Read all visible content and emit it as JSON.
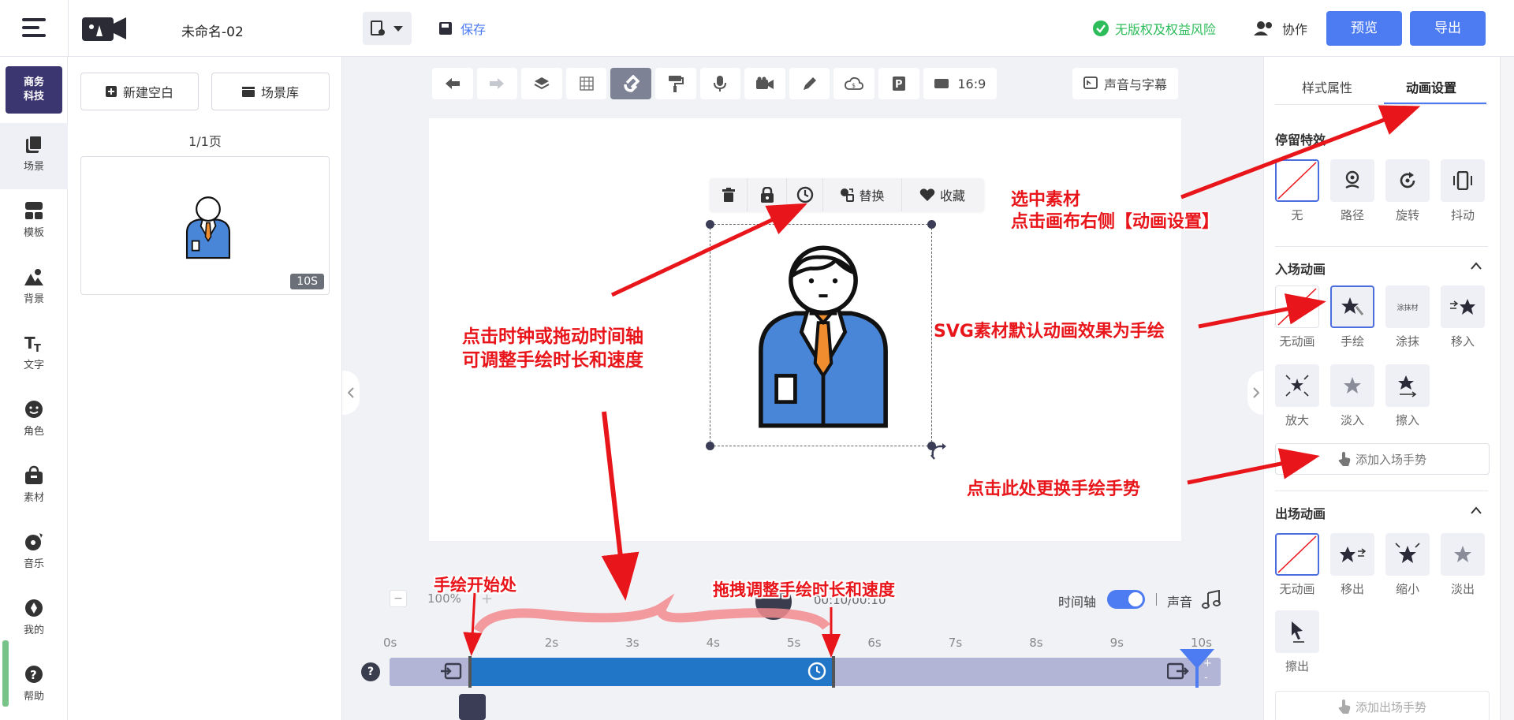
{
  "header": {
    "title": "未命名-02",
    "save_label": "保存",
    "copyright_notice": "无版权及权益风险",
    "collab_label": "协作",
    "preview_label": "预览",
    "export_label": "导出"
  },
  "colors": {
    "primary": "#4d7cf2",
    "danger": "#e8151a",
    "timeline_blue": "#2176c8",
    "timeline_gray": "#b2b5d6"
  },
  "sidebar": {
    "logo_text": "商务\n科技",
    "items": [
      {
        "label": "场景",
        "icon": "scene-icon"
      },
      {
        "label": "模板",
        "icon": "template-icon"
      },
      {
        "label": "背景",
        "icon": "background-icon"
      },
      {
        "label": "文字",
        "icon": "text-icon"
      },
      {
        "label": "角色",
        "icon": "character-icon"
      },
      {
        "label": "素材",
        "icon": "material-icon"
      },
      {
        "label": "音乐",
        "icon": "music-icon"
      },
      {
        "label": "我的",
        "icon": "mine-icon"
      },
      {
        "label": "帮助",
        "icon": "help-icon"
      }
    ]
  },
  "scene_panel": {
    "new_blank": "新建空白",
    "scene_library": "场景库",
    "page_indicator": "1/1页",
    "thumb_duration": "10S"
  },
  "toolbar": {
    "ratio": "16:9",
    "voice_subtitle": "声音与字幕"
  },
  "floating_bar": {
    "replace": "替换",
    "favorite": "收藏"
  },
  "right_panel": {
    "tabs": [
      "样式属性",
      "动画设置"
    ],
    "active_tab": 1,
    "stay_effect_title": "停留特效",
    "stay_effects": [
      "无",
      "路径",
      "旋转",
      "抖动"
    ],
    "enter_title": "入场动画",
    "enter_anims": [
      "无动画",
      "手绘",
      "涂抹",
      "移入",
      "放大",
      "淡入",
      "擦入"
    ],
    "enter_selected": "手绘",
    "smear_thumb_text": "涂抹材",
    "add_enter_gesture": "添加入场手势",
    "exit_title": "出场动画",
    "exit_anims": [
      "无动画",
      "移出",
      "缩小",
      "淡出",
      "擦出"
    ],
    "add_exit_gesture": "添加出场手势"
  },
  "timeline": {
    "zoom": "100%",
    "time_display": "00:10/00:10",
    "timeline_label": "时间轴",
    "timeline_on": true,
    "sound_label": "声音",
    "ticks": [
      "0s",
      "2s",
      "3s",
      "4s",
      "5s",
      "6s",
      "7s",
      "8s",
      "9s",
      "10s"
    ],
    "clip_start_s": 1,
    "clip_end_s": 5.5,
    "total_s": 10
  },
  "annotations": {
    "select_material_1": "选中素材",
    "select_material_2": "点击画布右侧【动画设置】",
    "svg_default": "SVG素材默认动画效果为手绘",
    "click_clock_1": "点击时钟或拖动时间轴",
    "click_clock_2": "可调整手绘时长和速度",
    "change_gesture": "点击此处更换手绘手势",
    "draw_start": "手绘开始处",
    "drag_adjust": "拖拽调整手绘时长和速度"
  }
}
